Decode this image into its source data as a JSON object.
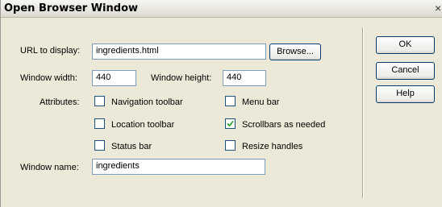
{
  "window": {
    "title": "Open Browser Window"
  },
  "form": {
    "url_label": "URL to display:",
    "url_value": "ingredients.html",
    "browse_label": "Browse...",
    "width_label": "Window width:",
    "width_value": "440",
    "height_label": "Window height:",
    "height_value": "440",
    "attributes_label": "Attributes:",
    "name_label": "Window name:",
    "name_value": "ingredients"
  },
  "attributes": [
    {
      "label": "Navigation toolbar",
      "checked": false
    },
    {
      "label": "Menu bar",
      "checked": false
    },
    {
      "label": "Location toolbar",
      "checked": false
    },
    {
      "label": "Scrollbars as needed",
      "checked": true
    },
    {
      "label": "Status bar",
      "checked": false
    },
    {
      "label": "Resize handles",
      "checked": false
    }
  ],
  "buttons": {
    "ok": "OK",
    "cancel": "Cancel",
    "help": "Help"
  }
}
